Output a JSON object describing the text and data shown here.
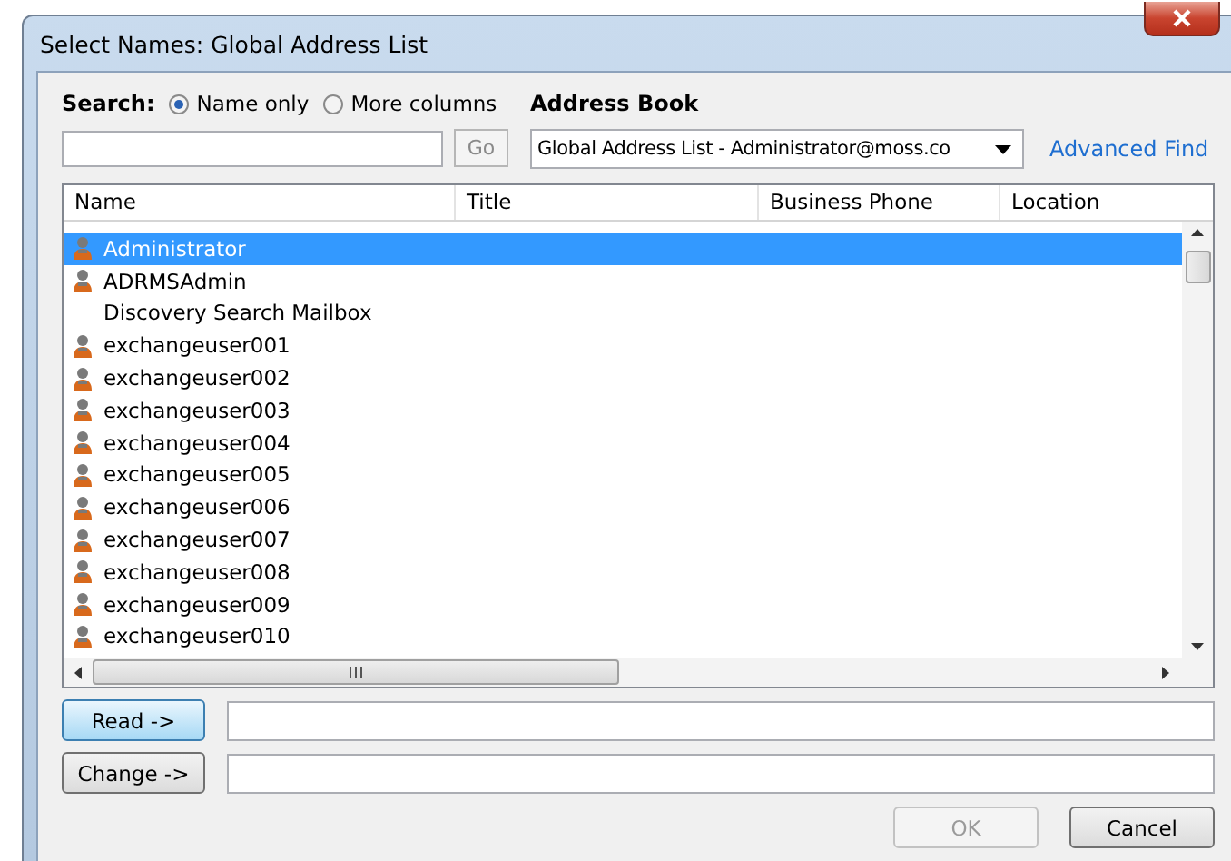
{
  "window": {
    "title": "Select Names: Global Address List"
  },
  "search": {
    "label": "Search:",
    "options": [
      {
        "label": "Name only",
        "selected": true
      },
      {
        "label": "More columns",
        "selected": false
      }
    ],
    "go_button": {
      "label": "Go",
      "disabled": true
    }
  },
  "address_book": {
    "label": "Address Book",
    "value": "Global Address List - Administrator@moss.co",
    "advanced_find": "Advanced Find"
  },
  "table": {
    "columns": [
      "Name",
      "Title",
      "Business Phone",
      "Location"
    ],
    "rows": [
      {
        "name": "Administrator",
        "kind": "user",
        "selected": true
      },
      {
        "name": "ADRMSAdmin",
        "kind": "user",
        "selected": false
      },
      {
        "name": "Discovery Search Mailbox",
        "kind": "mailbox",
        "selected": false
      },
      {
        "name": "exchangeuser001",
        "kind": "user",
        "selected": false
      },
      {
        "name": "exchangeuser002",
        "kind": "user",
        "selected": false
      },
      {
        "name": "exchangeuser003",
        "kind": "user",
        "selected": false
      },
      {
        "name": "exchangeuser004",
        "kind": "user",
        "selected": false
      },
      {
        "name": "exchangeuser005",
        "kind": "user",
        "selected": false
      },
      {
        "name": "exchangeuser006",
        "kind": "user",
        "selected": false
      },
      {
        "name": "exchangeuser007",
        "kind": "user",
        "selected": false
      },
      {
        "name": "exchangeuser008",
        "kind": "user",
        "selected": false
      },
      {
        "name": "exchangeuser009",
        "kind": "user",
        "selected": false
      },
      {
        "name": "exchangeuser010",
        "kind": "user",
        "selected": false
      }
    ]
  },
  "recipients": [
    {
      "label": "Read ->",
      "focused": true
    },
    {
      "label": "Change ->",
      "focused": false
    }
  ],
  "buttons": [
    {
      "label": "OK",
      "disabled": true
    },
    {
      "label": "Cancel",
      "disabled": false
    }
  ]
}
